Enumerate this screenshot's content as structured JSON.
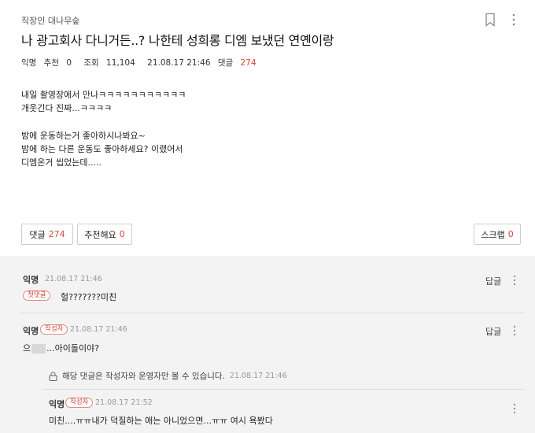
{
  "post": {
    "board": "직장인 대나무숲",
    "title": "나 광고회사 다니거든..? 나한테 성희롱 디엠 보냈던 연옌이랑",
    "meta": {
      "author": "익명",
      "recommend_label": "추천",
      "recommend_count": "0",
      "views_label": "조회",
      "views_count": "11,104",
      "date": "21.08.17 21:46",
      "comments_label": "댓글",
      "comments_count": "274"
    },
    "body_lines": [
      "내일 촬영장에서 만나ㅋㅋㅋㅋㅋㅋㅋㅋㅋㅋㅋ",
      "개웃긴다 진짜...ㅋㅋㅋㅋ",
      "",
      "밤에 운동하는거 좋아하시나봐요~",
      "밤에 하는 다른 운동도 좋아하세요? 이랬어서",
      "디엠온거 씹었는데....."
    ],
    "buttons": {
      "comment_label": "댓글",
      "comment_count": "274",
      "like_label": "추천해요",
      "like_count": "0",
      "scrap_label": "스크랩",
      "scrap_count": "0"
    }
  },
  "comments": [
    {
      "author": "익명",
      "date": "21.08.17 21:46",
      "badge": "첫댓글",
      "text": "헐???????미친",
      "reply_label": "답글"
    },
    {
      "author": "익명",
      "badge": "작성자",
      "date": "21.08.17 21:46",
      "text_before": "으",
      "text_after": "...아이돌이야?",
      "reply_label": "답글"
    }
  ],
  "hidden_note": {
    "text": "해당 댓글은 작성자와 운영자만 볼 수 있습니다.",
    "date": "21.08.17 21:46"
  },
  "reply": {
    "author": "익명",
    "badge": "작성자",
    "date": "21.08.17 21:52",
    "text": "미친....ㅠㅠ내가 덕질하는 애는 아니었으면...ㅠㅠ 여시 욕봤다"
  },
  "icons": {
    "bookmark": "bookmark-icon",
    "more": "more-vertical-icon",
    "lock": "lock-icon"
  },
  "colors": {
    "accent": "#d2453b",
    "background": "#f3f3f3"
  }
}
